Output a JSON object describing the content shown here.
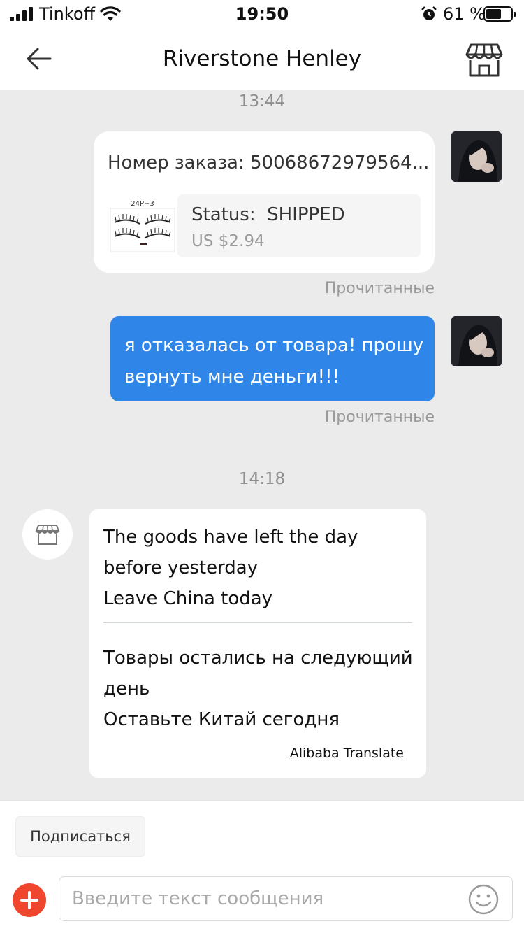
{
  "status_bar": {
    "carrier": "Tinkoff",
    "time": "19:50",
    "battery": "61 %",
    "battery_level": 0.61
  },
  "header": {
    "title": "Riverstone Henley",
    "back_icon": "arrow-left-icon",
    "store_icon": "storefront-icon"
  },
  "chat": {
    "timestamps": [
      "13:44",
      "14:18"
    ],
    "order_card": {
      "order_number": "Номер заказа: 50068672979564...",
      "product_image_label": "24P−3",
      "status": "Status:  SHIPPED",
      "price": "US $2.94"
    },
    "read_receipt_1": "Прочитанные",
    "read_receipt_2": "Прочитанные",
    "user_message": "я отказалась от товара! прошу вернуть мне деньги!!!",
    "reply": {
      "original_lines": [
        "The goods have left the day",
        "before yesterday",
        "Leave China today"
      ],
      "translated_lines": [
        "Товары остались на следующий",
        "день",
        "Оставьте Китай сегодня"
      ],
      "credit": "Alibaba Translate"
    }
  },
  "bottom": {
    "subscribe_label": "Подписаться",
    "input_placeholder": "Введите текст сообщения",
    "input_value": ""
  },
  "colors": {
    "accent_blue": "#2f86e8",
    "plus_red": "#f0462e",
    "chat_background": "#ebebeb"
  }
}
